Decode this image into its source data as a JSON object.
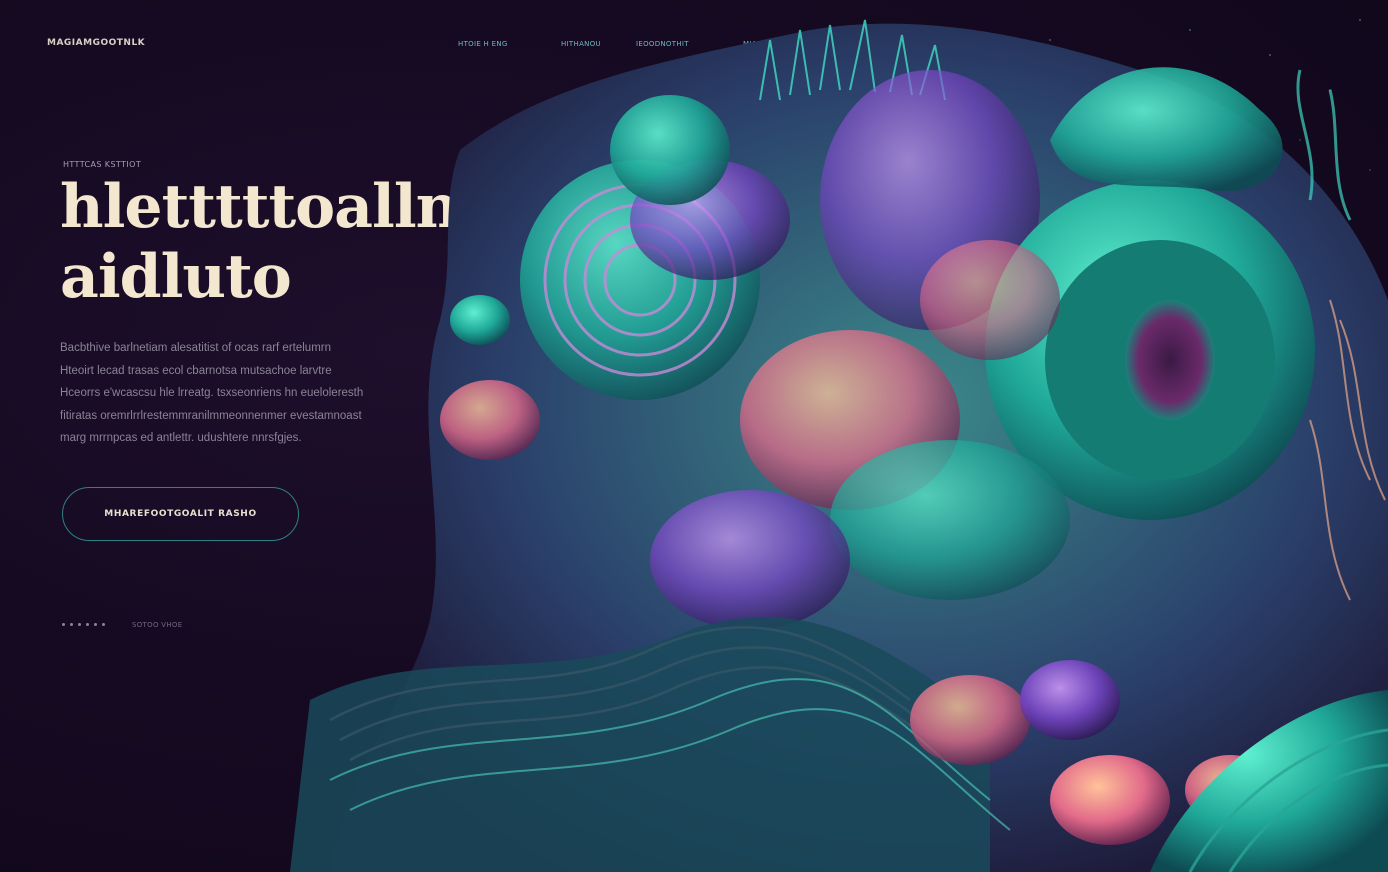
{
  "header": {
    "logo": "MAGIAMGOOTNLK",
    "nav": [
      {
        "label": "HTOIE H ENG"
      },
      {
        "label": "HITHANOU"
      },
      {
        "label": "IEOODNOTHIT"
      },
      {
        "label": "MIA OONO"
      }
    ]
  },
  "hero": {
    "eyebrow": "HTTTCAS KSTTIOT",
    "headline_line1": "hletttttoalln",
    "headline_line2": "aidluto",
    "body_lines": [
      "Bacbthive barlnetiam alesatitist of ocas rarf ertelumrn",
      "Hteoirt lecad trasas ecol cbarnotsa mutsachoe larvtre",
      "Hceorrs e'wcascsu hle lrreatg. tsxseonriens hn eueloleresth",
      "fitiratas oremrlrrlrestemmranilmmeonnenmer evestamnoast",
      "marg mrrnpcas ed antlettr. udushtere nnrsfgjes."
    ],
    "cta_label": "MHAREFOOTGOALIT RASHO",
    "scroll_label": "SOTOO VHOE"
  },
  "colors": {
    "background": "#160a22",
    "headline": "#f3e7cf",
    "accent_teal": "#2f7f86",
    "nav_text": "#6fb8c4"
  },
  "artwork": {
    "icon": "abstract-3d-coral-illustration"
  }
}
